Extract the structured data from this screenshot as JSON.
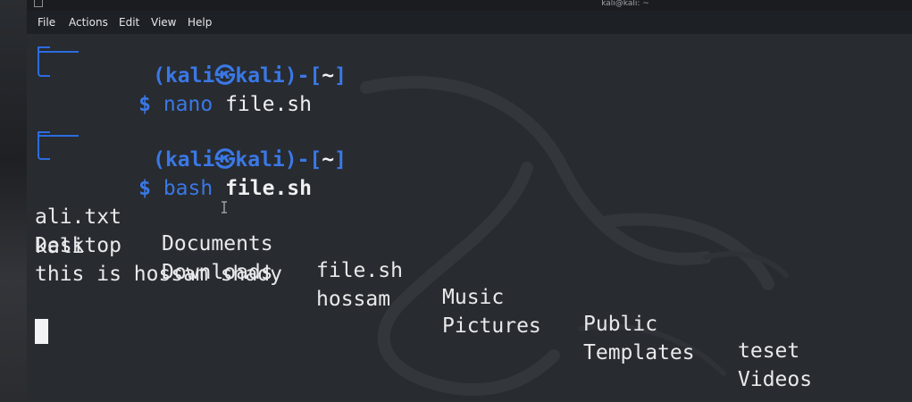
{
  "window": {
    "title": "kali@kali: ~"
  },
  "menu": {
    "items": [
      "File",
      "Actions",
      "Edit",
      "View",
      "Help"
    ]
  },
  "prompt1": {
    "open": "(",
    "user": "kali",
    "at": "㉿",
    "host": "kali",
    "mid": ")-[",
    "dir": "~",
    "close": "]",
    "dollar": "$",
    "command": "nano",
    "arg": "file.sh"
  },
  "prompt2": {
    "open": "(",
    "user": "kali",
    "at": "㉿",
    "host": "kali",
    "mid": ")-[",
    "dir": "~",
    "close": "]",
    "dollar": "$",
    "command": "bash",
    "arg": "file.sh"
  },
  "ls_output": {
    "row1": [
      "ali.txt",
      "Documents",
      "file.sh",
      "Music",
      "Public",
      "teset"
    ],
    "row2": [
      "Desktop",
      "Downloads",
      "hossam",
      "Pictures",
      "Templates",
      "Videos"
    ]
  },
  "output_lines": [
    "kali",
    "this is hossam shady"
  ],
  "colors": {
    "prompt_blue": "#3a78e6",
    "background": "#282b30"
  }
}
